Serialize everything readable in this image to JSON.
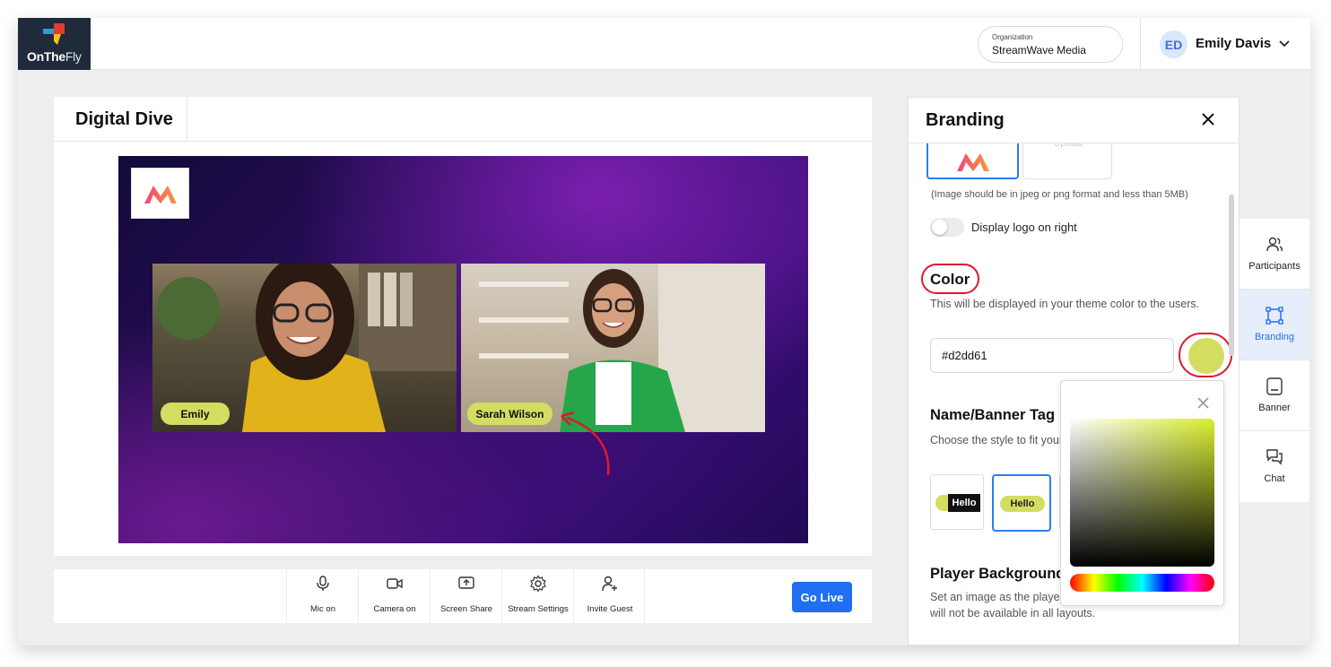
{
  "app": {
    "logo_text_bold": "OnThe",
    "logo_text_light": "Fly"
  },
  "org": {
    "label": "Organization",
    "name": "StreamWave Media"
  },
  "user": {
    "initials": "ED",
    "name": "Emily Davis"
  },
  "stage": {
    "title": "Digital Dive",
    "participants": [
      {
        "name": "Emily"
      },
      {
        "name": "Sarah Wilson"
      }
    ]
  },
  "controls": [
    {
      "label": "Mic on",
      "icon": "mic-icon"
    },
    {
      "label": "Camera on",
      "icon": "camera-icon"
    },
    {
      "label": "Screen Share",
      "icon": "screen-share-icon"
    },
    {
      "label": "Stream Settings",
      "icon": "gear-icon"
    },
    {
      "label": "Invite Guest",
      "icon": "add-user-icon"
    }
  ],
  "go_live_label": "Go Live",
  "branding": {
    "title": "Branding",
    "upload_label": "Upload",
    "image_note": "(Image should be in jpeg or png format and less than 5MB)",
    "toggle_label": "Display logo on right",
    "color_title": "Color",
    "color_desc": "This will be displayed in your theme color to the users.",
    "color_value": "#d2dd61",
    "name_tag_title": "Name/Banner Tag",
    "name_tag_desc": "Choose the style to fit your name and banner.",
    "style_sample": "Hello",
    "player_bg_title": "Player Background",
    "player_bg_desc": "Set an image as the player background. Background will not be available in all layouts."
  },
  "rail": [
    {
      "label": "Participants",
      "icon": "participants-icon",
      "active": false
    },
    {
      "label": "Branding",
      "icon": "branding-icon",
      "active": true
    },
    {
      "label": "Banner",
      "icon": "banner-icon",
      "active": false
    },
    {
      "label": "Chat",
      "icon": "chat-icon",
      "active": false
    }
  ],
  "colors": {
    "accent": "#1f6ff0",
    "theme": "#d2dd61",
    "highlight": "#e0162f"
  }
}
